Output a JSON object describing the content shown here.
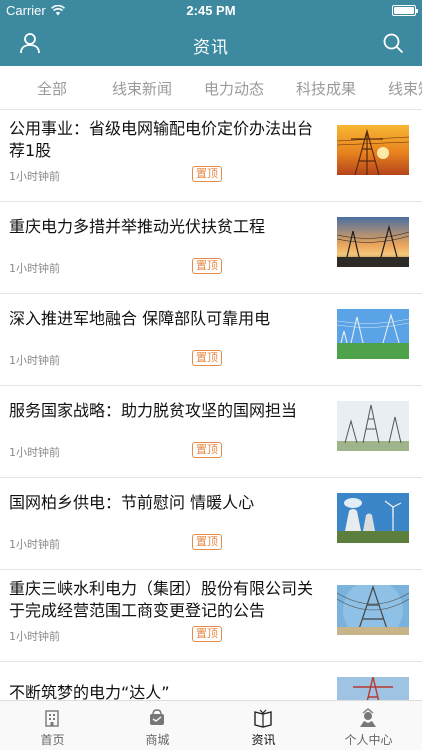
{
  "status_bar": {
    "carrier": "Carrier",
    "time": "2:45 PM"
  },
  "nav": {
    "title": "资讯",
    "left_icon": "user-icon",
    "right_icon": "search-icon"
  },
  "tabs": [
    {
      "label": "全部"
    },
    {
      "label": "线束新闻"
    },
    {
      "label": "电力动态"
    },
    {
      "label": "科技成果"
    },
    {
      "label": "线束知"
    }
  ],
  "articles": [
    {
      "title": "公用事业：省级电网输配电价定价办法出台 荐1股",
      "time": "1小时钟前",
      "badge": "置顶",
      "thumb": "sunset-tower"
    },
    {
      "title": "重庆电力多措并举推动光伏扶贫工程",
      "time": "1小时钟前",
      "badge": "置顶",
      "thumb": "dusk-lines"
    },
    {
      "title": "深入推进军地融合 保障部队可靠用电",
      "time": "1小时钟前",
      "badge": "置顶",
      "thumb": "field-towers"
    },
    {
      "title": "服务国家战略：助力脱贫攻坚的国网担当",
      "time": "1小时钟前",
      "badge": "置顶",
      "thumb": "pale-towers"
    },
    {
      "title": "国网柏乡供电：节前慰问 情暖人心",
      "time": "1小时钟前",
      "badge": "置顶",
      "thumb": "plant-windmill"
    },
    {
      "title": "重庆三峡水利电力（集团）股份有限公司关于完成经营范围工商变更登记的公告",
      "time": "1小时钟前",
      "badge": "置顶",
      "thumb": "fisheye-tower"
    },
    {
      "title": "不断筑梦的电力“达人”",
      "time": "",
      "badge": "",
      "thumb": "red-tower"
    }
  ],
  "tab_bar": [
    {
      "label": "首页",
      "icon": "home-building-icon"
    },
    {
      "label": "商城",
      "icon": "shop-icon"
    },
    {
      "label": "资讯",
      "icon": "news-book-icon"
    },
    {
      "label": "个人中心",
      "icon": "profile-icon"
    }
  ],
  "colors": {
    "accent": "#3d8aa0",
    "badge": "#e88a48"
  }
}
